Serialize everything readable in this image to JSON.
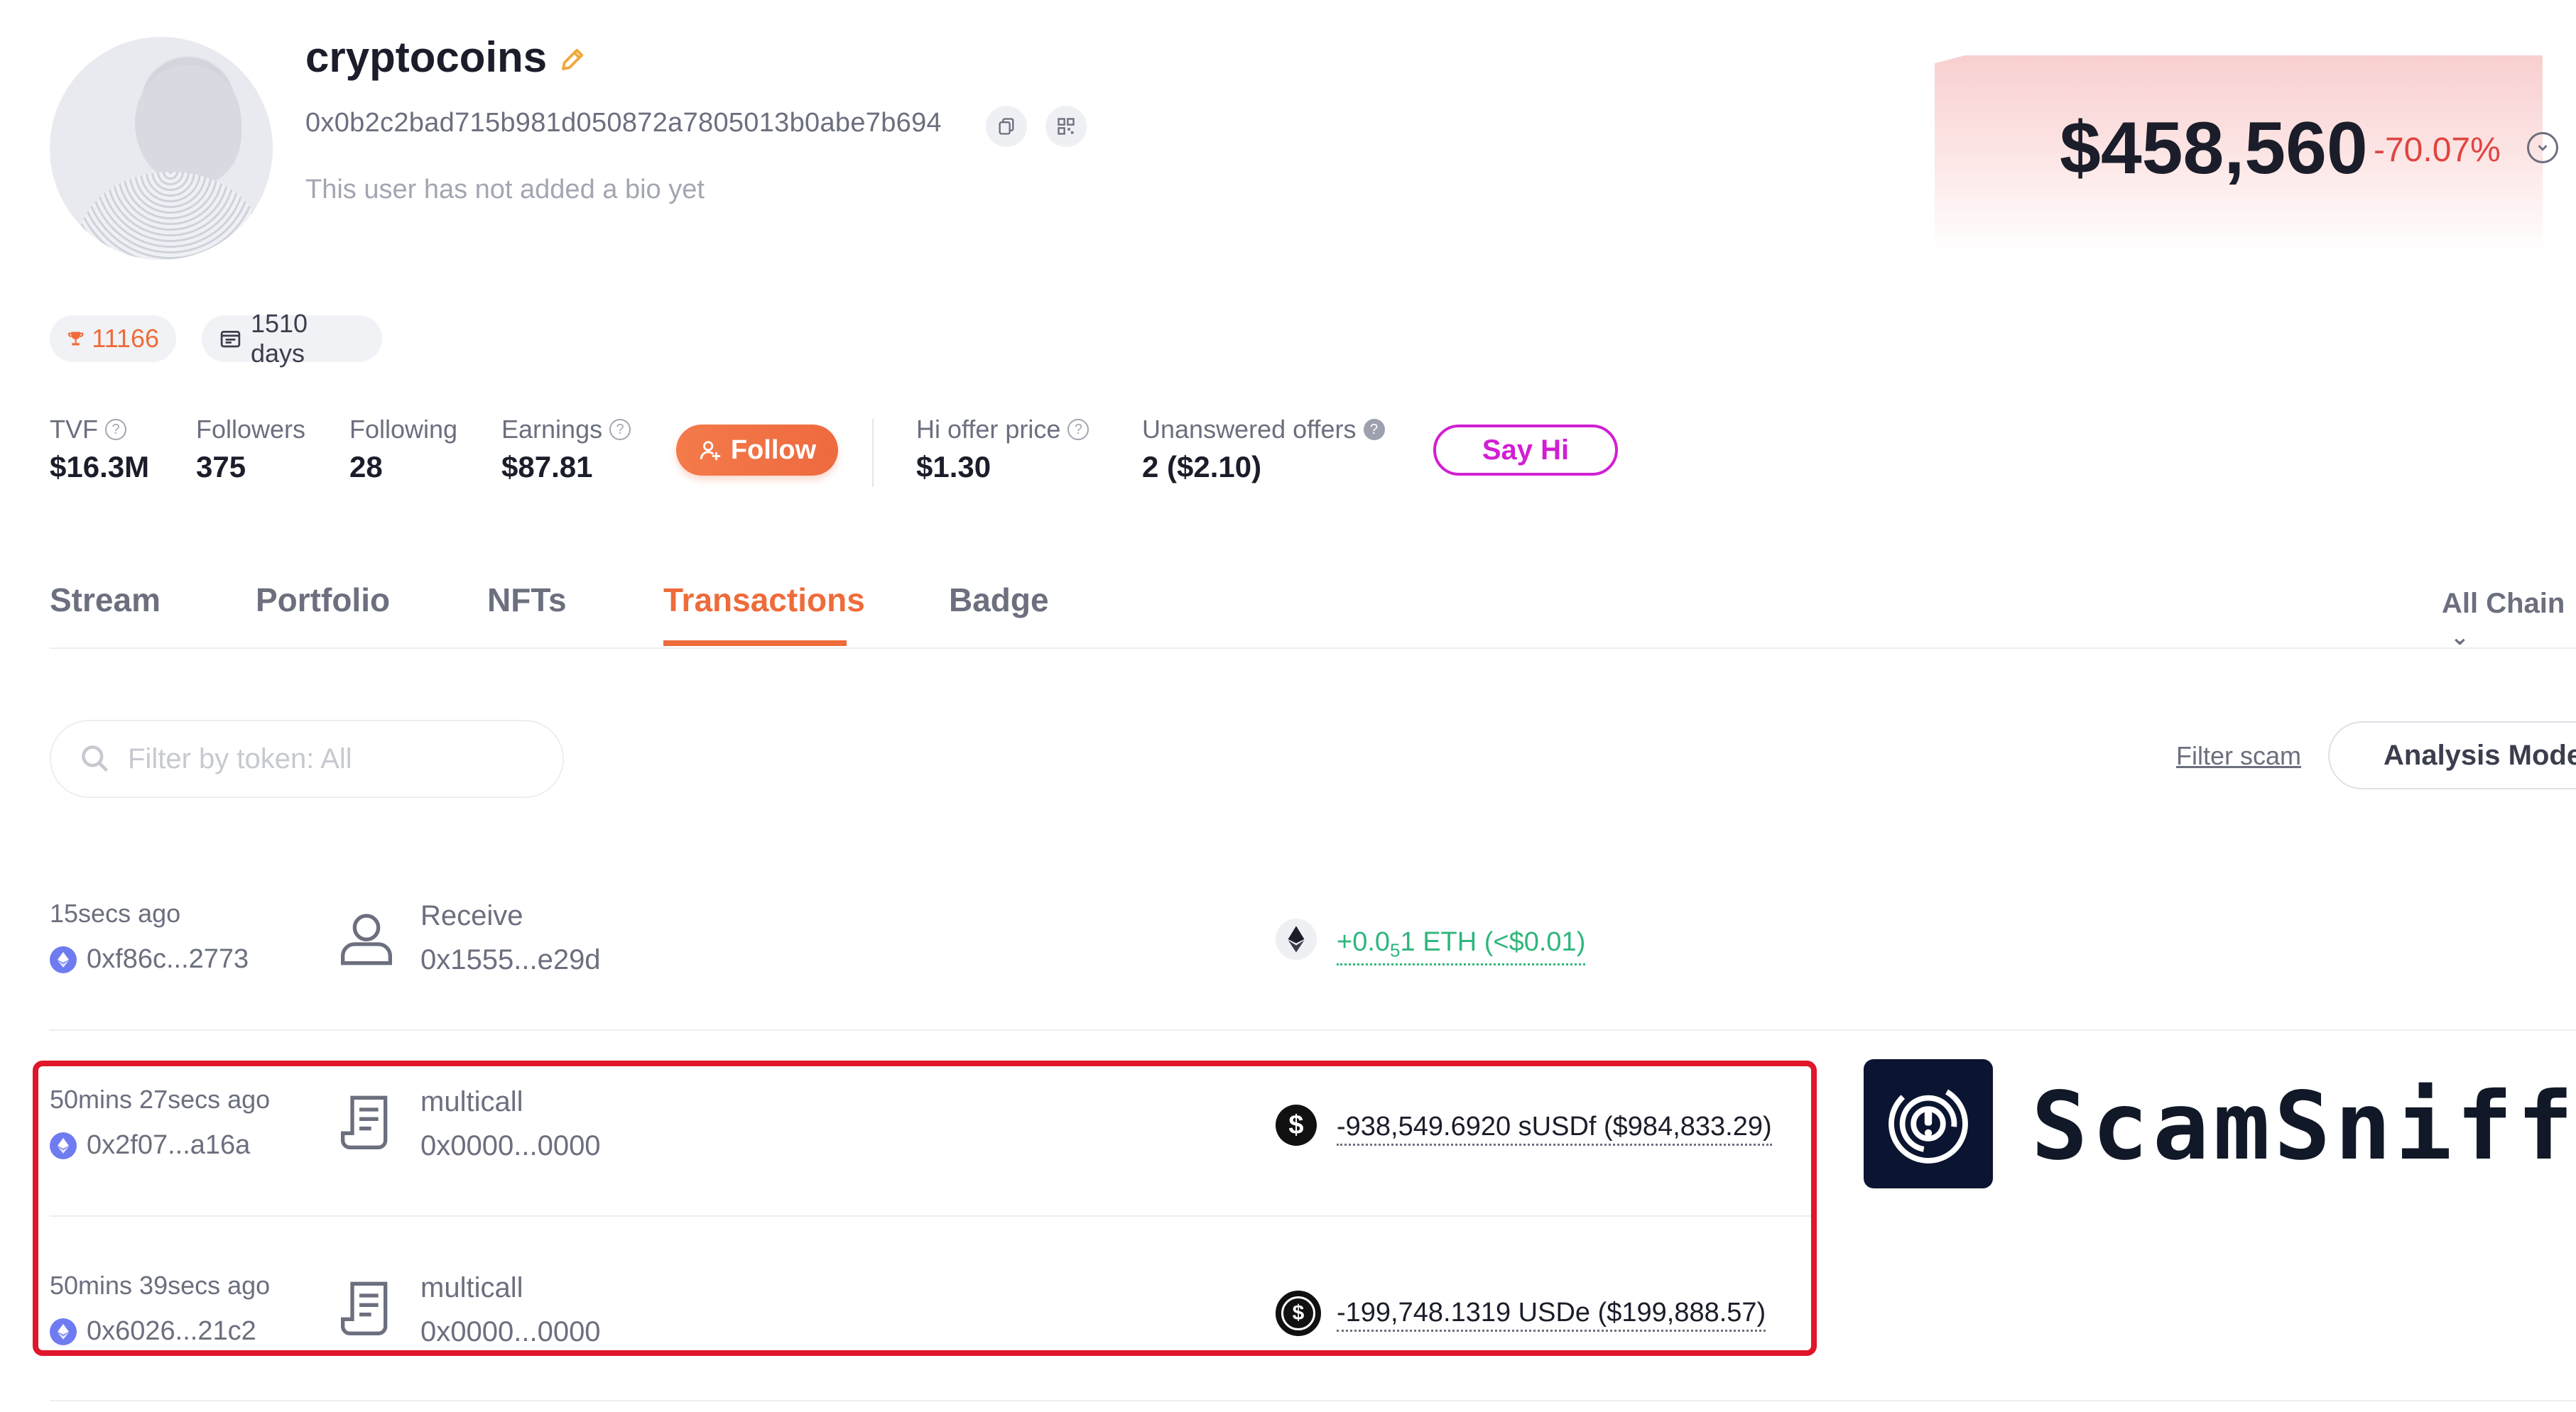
{
  "profile": {
    "username": "cryptocoins",
    "address": "0x0b2c2bad715b981d050872a7805013b0abe7b694",
    "bio": "This user has not added a bio yet",
    "rank": "11166",
    "days": "1510 days"
  },
  "networth": {
    "value": "$458,560",
    "change": "-70.07%"
  },
  "stats": {
    "tvf": {
      "label": "TVF",
      "value": "$16.3M"
    },
    "followers": {
      "label": "Followers",
      "value": "375"
    },
    "following": {
      "label": "Following",
      "value": "28"
    },
    "earnings": {
      "label": "Earnings",
      "value": "$87.81"
    },
    "hi_offer": {
      "label": "Hi offer price",
      "value": "$1.30"
    },
    "unanswered": {
      "label": "Unanswered offers",
      "value": "2 ($2.10)"
    }
  },
  "buttons": {
    "follow": "Follow",
    "say_hi": "Say Hi",
    "filter_scam": "Filter scam",
    "analysis_mode": "Analysis Mode"
  },
  "tabs": [
    "Stream",
    "Portfolio",
    "NFTs",
    "Transactions",
    "Badge"
  ],
  "active_tab": "Transactions",
  "chain_filter": "All Chain",
  "search": {
    "placeholder": "Filter by token: All"
  },
  "transactions": [
    {
      "time": "15secs ago",
      "hash": "0xf86c...2773",
      "type": "Receive",
      "counterparty": "0x1555...e29d",
      "token": "eth-icon",
      "amount_prefix": "+0.0",
      "amount_sub": "5",
      "amount_rest": "1 ETH (<$0.01)"
    },
    {
      "time": "50mins 27secs ago",
      "hash": "0x2f07...a16a",
      "type": "multicall",
      "counterparty": "0x0000...0000",
      "token": "susdf-icon",
      "amount": "-938,549.6920 sUSDf ($984,833.29)"
    },
    {
      "time": "50mins 39secs ago",
      "hash": "0x6026...21c2",
      "type": "multicall",
      "counterparty": "0x0000...0000",
      "token": "usde-icon",
      "amount": "-199,748.1319 USDe ($199,888.57)"
    }
  ],
  "watermark": {
    "brand": "ScamSniffer"
  },
  "colors": {
    "accent": "#ee6b3a",
    "negative": "#e0453f",
    "positive": "#2fb67c",
    "say_hi": "#d11fd2",
    "highlight": "#e0162b"
  }
}
